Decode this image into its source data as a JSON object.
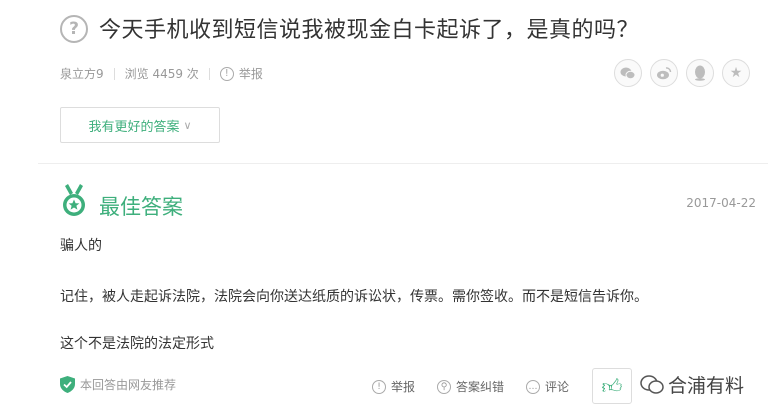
{
  "question": {
    "icon": "question-circle-icon",
    "title": "今天手机收到短信说我被现金白卡起诉了，是真的吗？"
  },
  "meta": {
    "author": "泉立方9",
    "views": "浏览 4459 次",
    "report": "举报"
  },
  "share_icons": [
    "wechat-icon",
    "weibo-icon",
    "qq-icon",
    "star-icon"
  ],
  "better_answer_button": "我有更好的答案",
  "best_answer": {
    "title": "最佳答案",
    "date": "2017-04-22",
    "lines": [
      "骗人的",
      "记住，被人走起诉法院，法院会向你送达纸质的诉讼状，传票。需你签收。而不是短信告诉你。",
      "这个不是法院的法定形式"
    ],
    "recommend": "本回答由网友推荐",
    "actions": {
      "report": "举报",
      "correct": "答案纠错",
      "comment": "评论"
    }
  },
  "watermark": "合浦有料",
  "colors": {
    "accent": "#3eaf7c",
    "muted": "#999999"
  }
}
